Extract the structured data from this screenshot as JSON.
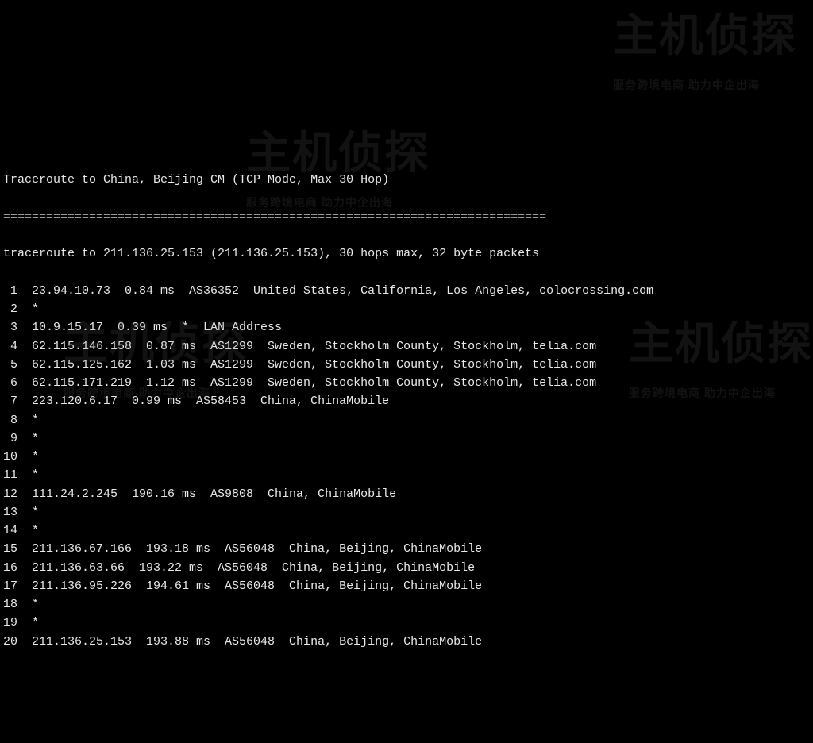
{
  "title": "Traceroute to China, Beijing CM (TCP Mode, Max 30 Hop)",
  "divider": "============================================================================",
  "command_line": "traceroute to 211.136.25.153 (211.136.25.153), 30 hops max, 32 byte packets",
  "watermark": {
    "brand": "主机侦探",
    "tagline": "服务跨境电商 助力中企出海"
  },
  "hops": [
    {
      "n": "1",
      "ip": "23.94.10.73",
      "rtt": "0.84 ms",
      "asn": "AS36352",
      "loc": "United States, California, Los Angeles, colocrossing.com"
    },
    {
      "n": "2",
      "ip": "*",
      "rtt": "",
      "asn": "",
      "loc": ""
    },
    {
      "n": "3",
      "ip": "10.9.15.17",
      "rtt": "0.39 ms",
      "asn": "*",
      "loc": "LAN Address"
    },
    {
      "n": "4",
      "ip": "62.115.146.158",
      "rtt": "0.87 ms",
      "asn": "AS1299",
      "loc": "Sweden, Stockholm County, Stockholm, telia.com"
    },
    {
      "n": "5",
      "ip": "62.115.125.162",
      "rtt": "1.03 ms",
      "asn": "AS1299",
      "loc": "Sweden, Stockholm County, Stockholm, telia.com"
    },
    {
      "n": "6",
      "ip": "62.115.171.219",
      "rtt": "1.12 ms",
      "asn": "AS1299",
      "loc": "Sweden, Stockholm County, Stockholm, telia.com"
    },
    {
      "n": "7",
      "ip": "223.120.6.17",
      "rtt": "0.99 ms",
      "asn": "AS58453",
      "loc": "China, ChinaMobile"
    },
    {
      "n": "8",
      "ip": "*",
      "rtt": "",
      "asn": "",
      "loc": ""
    },
    {
      "n": "9",
      "ip": "*",
      "rtt": "",
      "asn": "",
      "loc": ""
    },
    {
      "n": "10",
      "ip": "*",
      "rtt": "",
      "asn": "",
      "loc": ""
    },
    {
      "n": "11",
      "ip": "*",
      "rtt": "",
      "asn": "",
      "loc": ""
    },
    {
      "n": "12",
      "ip": "111.24.2.245",
      "rtt": "190.16 ms",
      "asn": "AS9808",
      "loc": "China, ChinaMobile"
    },
    {
      "n": "13",
      "ip": "*",
      "rtt": "",
      "asn": "",
      "loc": ""
    },
    {
      "n": "14",
      "ip": "*",
      "rtt": "",
      "asn": "",
      "loc": ""
    },
    {
      "n": "15",
      "ip": "211.136.67.166",
      "rtt": "193.18 ms",
      "asn": "AS56048",
      "loc": "China, Beijing, ChinaMobile"
    },
    {
      "n": "16",
      "ip": "211.136.63.66",
      "rtt": "193.22 ms",
      "asn": "AS56048",
      "loc": "China, Beijing, ChinaMobile"
    },
    {
      "n": "17",
      "ip": "211.136.95.226",
      "rtt": "194.61 ms",
      "asn": "AS56048",
      "loc": "China, Beijing, ChinaMobile"
    },
    {
      "n": "18",
      "ip": "*",
      "rtt": "",
      "asn": "",
      "loc": ""
    },
    {
      "n": "19",
      "ip": "*",
      "rtt": "",
      "asn": "",
      "loc": ""
    },
    {
      "n": "20",
      "ip": "211.136.25.153",
      "rtt": "193.88 ms",
      "asn": "AS56048",
      "loc": "China, Beijing, ChinaMobile"
    }
  ]
}
